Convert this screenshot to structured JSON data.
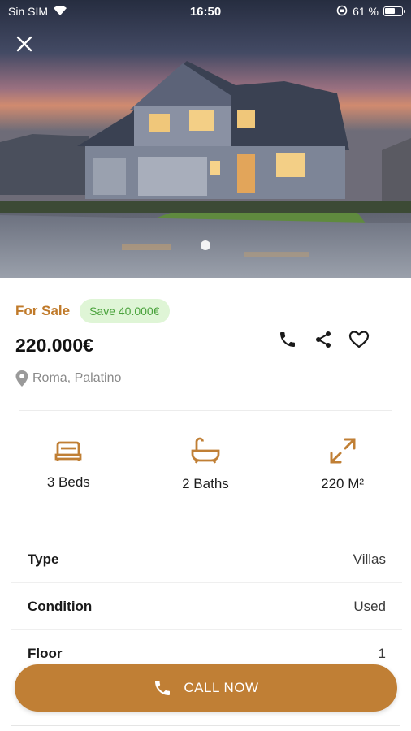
{
  "status_bar": {
    "carrier": "Sin SIM",
    "time": "16:50",
    "battery_percent": "61 %",
    "battery_level": 0.61,
    "icons": [
      "wifi-icon",
      "orientation-lock-icon",
      "battery-icon"
    ]
  },
  "hero": {
    "image": "house-photo",
    "close_icon": "close-icon",
    "carousel_dots": 1
  },
  "listing": {
    "status": "For Sale",
    "savings": "Save 40.000€",
    "price": "220.000€",
    "location": "Roma, Palatino",
    "actions": [
      "phone-icon",
      "share-icon",
      "heart-icon"
    ]
  },
  "features": [
    {
      "icon": "bed-icon",
      "label": "3 Beds"
    },
    {
      "icon": "bath-icon",
      "label": "2 Baths"
    },
    {
      "icon": "expand-icon",
      "label": "220 M²"
    }
  ],
  "details": [
    {
      "key": "Type",
      "value": "Villas"
    },
    {
      "key": "Condition",
      "value": "Used"
    },
    {
      "key": "Floor",
      "value": "1"
    }
  ],
  "cta": {
    "label": "CALL NOW",
    "icon": "phone-icon"
  },
  "colors": {
    "accent": "#c07f35",
    "status_text": "#c07a2a",
    "badge_bg": "#dff5d6",
    "badge_text": "#4aa23c"
  }
}
